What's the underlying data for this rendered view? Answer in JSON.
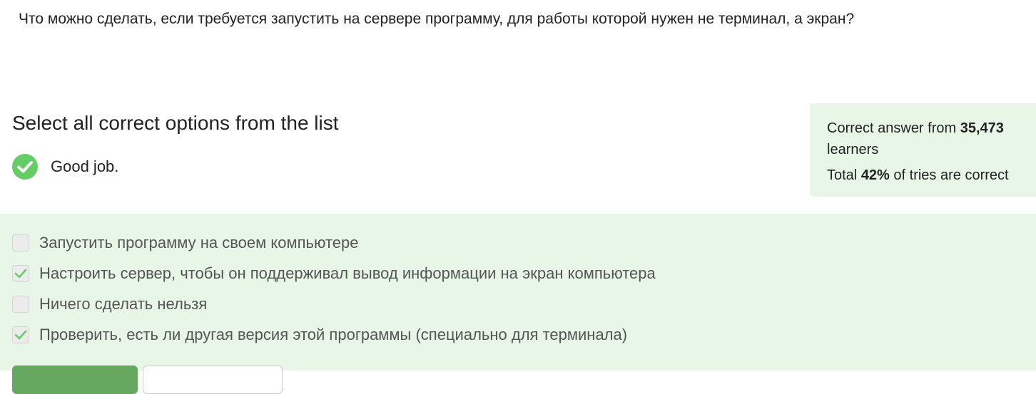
{
  "question": {
    "text": "Что можно сделать, если требуется запустить на сервере программу, для работы которой нужен не терминал, а экран?"
  },
  "task": {
    "heading": "Select all correct options from the list"
  },
  "feedback": {
    "icon": "check-circle-icon",
    "text": "Good job."
  },
  "stats": {
    "line1_prefix": "Correct answer from ",
    "learners_count": "35,473",
    "line1_suffix": "learners",
    "line2_prefix": "Total ",
    "percent": "42%",
    "line2_suffix": " of tries are correct"
  },
  "options": [
    {
      "label": "Запустить программу на своем компьютере",
      "checked": false
    },
    {
      "label": "Настроить сервер, чтобы он поддерживал вывод информации на экран компьютера",
      "checked": true
    },
    {
      "label": "Ничего сделать нельзя",
      "checked": false
    },
    {
      "label": "Проверить, есть ли другая версия этой программы (специально для терминала)",
      "checked": true
    }
  ],
  "colors": {
    "success_green": "#66cc66",
    "panel_bg": "#e8f6e8",
    "checkmark": "#66cc66",
    "primary_button": "#66a85f"
  }
}
